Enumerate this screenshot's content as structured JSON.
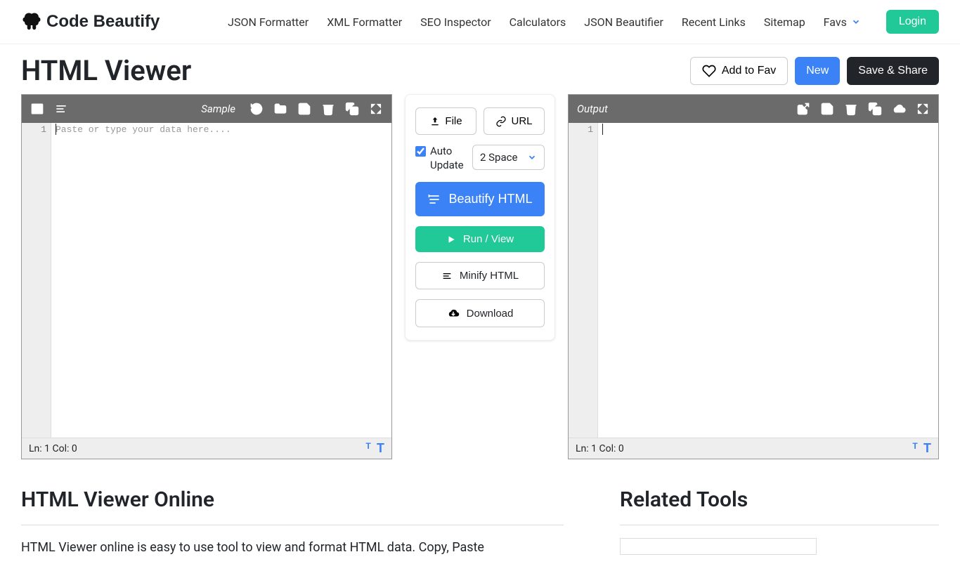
{
  "header": {
    "brand": "Code Beautify",
    "nav": [
      "JSON Formatter",
      "XML Formatter",
      "SEO Inspector",
      "Calculators",
      "JSON Beautifier",
      "Recent Links",
      "Sitemap"
    ],
    "favs_label": "Favs",
    "login_label": "Login"
  },
  "title": {
    "text": "HTML Viewer",
    "add_fav": "Add to Fav",
    "new": "New",
    "save": "Save & Share"
  },
  "input_panel": {
    "sample_label": "Sample",
    "placeholder": "Paste or type your data here....",
    "gutter": "1",
    "status": "Ln: 1 Col: 0"
  },
  "output_panel": {
    "label": "Output",
    "gutter": "1",
    "status": "Ln: 1 Col: 0"
  },
  "middle": {
    "file_label": "File",
    "url_label": "URL",
    "auto_update": "Auto Update",
    "indent_selected": "2 Space",
    "beautify": "Beautify HTML",
    "run": "Run / View",
    "minify": "Minify HTML",
    "download": "Download"
  },
  "bottom": {
    "title": "HTML Viewer Online",
    "desc": "HTML Viewer online is easy to use tool to view and format HTML data. Copy, Paste",
    "related": "Related Tools"
  }
}
